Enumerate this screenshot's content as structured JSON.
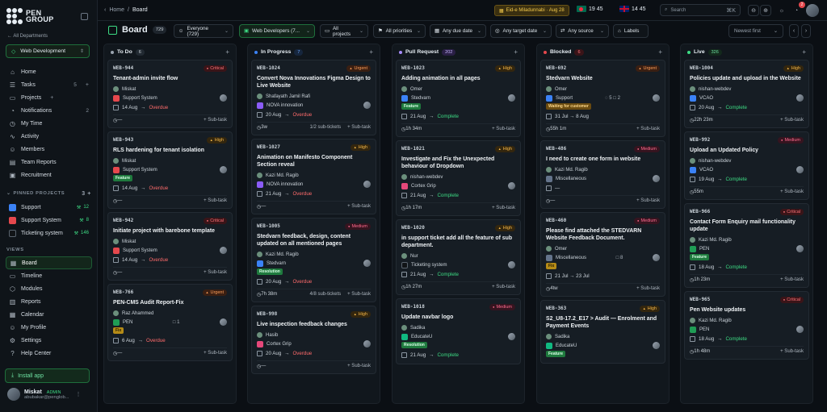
{
  "sidebar": {
    "logo_line1": "PEN",
    "logo_line2": "GROUP",
    "back_label": "← All Departments",
    "workspace": "Web Development",
    "nav": [
      {
        "label": "Home",
        "icon": "home-icon",
        "glyph": "⌂"
      },
      {
        "label": "Tasks",
        "icon": "tasks-icon",
        "glyph": "☰",
        "badge": "5",
        "plus": "+"
      },
      {
        "label": "Projects",
        "icon": "folder-icon",
        "glyph": "▭",
        "plus": "+"
      },
      {
        "label": "Notifications",
        "icon": "bell-icon",
        "glyph": "◔",
        "badge": "2"
      },
      {
        "label": "My Time",
        "icon": "clock-icon",
        "glyph": "◷"
      },
      {
        "label": "Activity",
        "icon": "activity-icon",
        "glyph": "∿"
      },
      {
        "label": "Members",
        "icon": "members-icon",
        "glyph": "☺"
      },
      {
        "label": "Team Reports",
        "icon": "report-icon",
        "glyph": "▤"
      },
      {
        "label": "Recruitment",
        "icon": "briefcase-icon",
        "glyph": "▣"
      }
    ],
    "pinned_title": "PINNED PROJECTS",
    "pinned_tools": "3 +",
    "pinned": [
      {
        "label": "Support",
        "color": "#3b82f6",
        "count": "12"
      },
      {
        "label": "Support System",
        "color": "#e5484d",
        "count": "8"
      },
      {
        "label": "Ticketing system",
        "color": "#111417",
        "count": "146"
      }
    ],
    "views_title": "VIEWS",
    "views": [
      {
        "label": "Board",
        "icon": "board-icon",
        "glyph": "▦",
        "active": true
      },
      {
        "label": "Timeline",
        "icon": "timeline-icon",
        "glyph": "▭"
      },
      {
        "label": "Modules",
        "icon": "modules-icon",
        "glyph": "⬡"
      },
      {
        "label": "Reports",
        "icon": "reports-icon",
        "glyph": "▥"
      },
      {
        "label": "Calendar",
        "icon": "calendar-icon",
        "glyph": "▦"
      },
      {
        "label": "My Profile",
        "icon": "profile-icon",
        "glyph": "☺"
      },
      {
        "label": "Settings",
        "icon": "gear-icon",
        "glyph": "⚙"
      },
      {
        "label": "Help Center",
        "icon": "help-icon",
        "glyph": "?"
      }
    ],
    "install_label": "Install app",
    "user_name": "Miskat",
    "user_role": "ADMIN",
    "user_email": "abubakar@penglob..."
  },
  "topbar": {
    "crumb_home": "Home",
    "crumb_sep": "/",
    "crumb_current": "Board",
    "eid": "Eid-e Miladunnabi · Aug 28",
    "clock_bd": "19 45",
    "clock_uk": "14 45",
    "search_placeholder": "Search",
    "search_kbd": "⌘K",
    "notif_count": "2"
  },
  "filters": {
    "title": "Board",
    "count": "729",
    "everyone": "Everyone (729)",
    "team": "Web Developers (7...",
    "projects": "All projects",
    "priorities": "All priorities",
    "due": "Any due date",
    "target": "Any target date",
    "source": "Any source",
    "labels": "Labels",
    "sort": "Newest first"
  },
  "columns": [
    {
      "name": "To Do",
      "count": "6",
      "dot": "#9aa4af",
      "count_bg": "#222a32",
      "count_color": "#cbd3da",
      "cards": [
        {
          "key": "WEB-944",
          "prio": "Critical",
          "pcls": "critical",
          "title": "Tenant-admin invite flow",
          "person": "Miskat",
          "project": "Support System",
          "pcolor": "#e5484d",
          "date": "14 Aug",
          "status": "Overdue",
          "scls": "overdue",
          "left": "—",
          "sub": "+ Sub-task"
        },
        {
          "key": "WEB-943",
          "prio": "High",
          "pcls": "high",
          "title": "RLS hardening for tenant isolation",
          "person": "Miskat",
          "project": "Support System",
          "pcolor": "#e5484d",
          "tag": "Feature",
          "tcls": "feature",
          "date": "14 Aug",
          "status": "Overdue",
          "scls": "overdue",
          "left": "—",
          "sub": "+ Sub-task"
        },
        {
          "key": "WEB-942",
          "prio": "Critical",
          "pcls": "critical",
          "title": "Initiate project with barebone template",
          "person": "Miskat",
          "project": "Support System",
          "pcolor": "#e5484d",
          "date": "14 Aug",
          "status": "Overdue",
          "scls": "overdue",
          "left": "—",
          "sub": "+ Sub-task"
        },
        {
          "key": "WEB-766",
          "prio": "Urgent",
          "pcls": "urgent",
          "title": "PEN-CMS Audit Report-Fix",
          "person": "Raz Ahammed",
          "project": "PEN",
          "pcolor": "#1f9d55",
          "tag": "Fix",
          "tcls": "fix",
          "meta": "□ 1",
          "date": "6 Aug",
          "status": "Overdue",
          "scls": "overdue",
          "left": "—",
          "sub": "+ Sub-task"
        }
      ]
    },
    {
      "name": "In Progress",
      "count": "7",
      "dot": "#3b82f6",
      "count_bg": "#16263d",
      "count_color": "#6aa5ff",
      "cards": [
        {
          "key": "WEB-1024",
          "prio": "Urgent",
          "pcls": "urgent",
          "title": "Convert Nova Innovations Figma Design to Live Website",
          "person": "Shafayath Jamil Rafi",
          "project": "NOVA innovation",
          "pcolor": "#8b5cf6",
          "date": "20 Aug",
          "status": "Overdue",
          "scls": "overdue",
          "left": "3w",
          "mid": "1/2 sub-tickets",
          "sub": "+ Sub-task"
        },
        {
          "key": "WEB-1027",
          "prio": "High",
          "pcls": "high",
          "title": "Animation on Manifesto Component Section reveal",
          "person": "Kazi Md. Ragib",
          "project": "NOVA innovation",
          "pcolor": "#8b5cf6",
          "date": "21 Aug",
          "status": "Overdue",
          "scls": "overdue",
          "left": "—",
          "sub": "+ Sub-task"
        },
        {
          "key": "WEB-1005",
          "prio": "Medium",
          "pcls": "medium",
          "title": "Stedvarn feedback, design, content updated on all mentioned pages",
          "person": "Kazi Md. Ragib",
          "project": "Stedvarn",
          "pcolor": "#3b82f6",
          "tag": "Resolution",
          "tcls": "resolution",
          "date": "20 Aug",
          "status": "Overdue",
          "scls": "overdue",
          "left": "7h 38m",
          "mid": "4/8 sub-tickets",
          "sub": "+ Sub-task"
        },
        {
          "key": "WEB-998",
          "prio": "High",
          "pcls": "high",
          "title": "Live inspection feedback changes",
          "person": "Hasib",
          "project": "Cortex Grip",
          "pcolor": "#e5487a",
          "date": "20 Aug",
          "status": "Overdue",
          "scls": "overdue",
          "left": "—",
          "sub": "+ Sub-task"
        }
      ]
    },
    {
      "name": "Pull Request",
      "count": "202",
      "dot": "#a78bfa",
      "count_bg": "#2a1f45",
      "count_color": "#c4b5fd",
      "cards": [
        {
          "key": "WEB-1023",
          "prio": "High",
          "pcls": "high",
          "title": "Adding animation in all pages",
          "person": "Omer",
          "project": "Stedvarn",
          "pcolor": "#3b82f6",
          "tag": "Feature",
          "tcls": "feature",
          "date": "21 Aug",
          "status": "Complete",
          "scls": "complete",
          "left": "1h 34m",
          "sub": "+ Sub-task"
        },
        {
          "key": "WEB-1021",
          "prio": "High",
          "pcls": "high",
          "title": "Investigate and Fix the Unexpected behaviour of Dropdown",
          "person": "nishan-webdev",
          "project": "Cortex Grip",
          "pcolor": "#e5487a",
          "date": "21 Aug",
          "status": "Complete",
          "scls": "complete",
          "left": "1h 17m",
          "sub": "+ Sub-task"
        },
        {
          "key": "WEB-1020",
          "prio": "High",
          "pcls": "high",
          "title": "in support ticket add all the feature of sub department.",
          "person": "Nur",
          "project": "Ticketing system",
          "pcolor": "#111417",
          "date": "21 Aug",
          "status": "Complete",
          "scls": "complete",
          "left": "1h 27m",
          "sub": "+ Sub-task"
        },
        {
          "key": "WEB-1018",
          "prio": "Medium",
          "pcls": "medium",
          "title": "Update navbar logo",
          "person": "Sadika",
          "project": "EducateU",
          "pcolor": "#10b981",
          "tag": "Resolution",
          "tcls": "resolution",
          "date": "21 Aug",
          "status": "Complete",
          "scls": "complete",
          "left": "",
          "sub": ""
        }
      ]
    },
    {
      "name": "Blocked",
      "count": "6",
      "dot": "#e5484d",
      "count_bg": "#3a1418",
      "count_color": "#ff7379",
      "cards": [
        {
          "key": "WEB-692",
          "prio": "Urgent",
          "pcls": "urgent",
          "title": "Stedvarn Website",
          "person": "Omer",
          "project": "Support",
          "pcolor": "#3b82f6",
          "tag": "Waiting for customer",
          "tcls": "waiting",
          "meta": "◌ 5   □ 2",
          "date": "31 Jul → 8 Aug",
          "status": "",
          "scls": "",
          "left": "55h 1m",
          "sub": "+ Sub-task"
        },
        {
          "key": "WEB-486",
          "prio": "Medium",
          "pcls": "medium",
          "title": "I need to create one form in website",
          "person": "Kazi Md. Ragib",
          "project": "Miscellaneous",
          "pcolor": "#64748b",
          "date": "—",
          "status": "",
          "scls": "",
          "left": "—",
          "sub": "+ Sub-task"
        },
        {
          "key": "WEB-460",
          "prio": "Medium",
          "pcls": "medium",
          "title": "Please find attached the STEDVARN Website Feedback Document.",
          "person": "Omer",
          "project": "Miscellaneous",
          "pcolor": "#64748b",
          "tag": "Fix",
          "tcls": "fix",
          "meta": "□ 8",
          "date": "21 Jul → 23 Jul",
          "status": "",
          "scls": "",
          "left": "4tw",
          "sub": "+ Sub-task"
        },
        {
          "key": "WEB-363",
          "prio": "High",
          "pcls": "high",
          "title": "S2_U8-17.2_E17 > Audit — Enrolment and Payment Events",
          "person": "Sadika",
          "project": "EducateU",
          "pcolor": "#10b981",
          "tag": "Feature",
          "tcls": "feature",
          "date": "",
          "status": "",
          "scls": "",
          "left": "",
          "sub": ""
        }
      ]
    },
    {
      "name": "Live",
      "count": "326",
      "dot": "#3ddc84",
      "count_bg": "#13291c",
      "count_color": "#6fe3a3",
      "cards": [
        {
          "key": "WEB-1004",
          "prio": "High",
          "pcls": "high",
          "title": "Policies update and upload in the Website",
          "person": "nishan-webdev",
          "project": "VCAO",
          "pcolor": "#3b82f6",
          "date": "20 Aug",
          "status": "Complete",
          "scls": "complete",
          "left": "22h 23m",
          "sub": "+ Sub-task"
        },
        {
          "key": "WEB-992",
          "prio": "Medium",
          "pcls": "medium",
          "title": "Upload an Updated Policy",
          "person": "nishan-webdev",
          "project": "VCAO",
          "pcolor": "#3b82f6",
          "date": "19 Aug",
          "status": "Complete",
          "scls": "complete",
          "left": "55m",
          "sub": "+ Sub-task"
        },
        {
          "key": "WEB-966",
          "prio": "Critical",
          "pcls": "critical",
          "title": "Contact Form Enquiry mail functionality update",
          "person": "Kazi Md. Ragib",
          "project": "PEN",
          "pcolor": "#1f9d55",
          "tag": "Feature",
          "tcls": "feature",
          "date": "18 Aug",
          "status": "Complete",
          "scls": "complete",
          "left": "1h 23m",
          "sub": "+ Sub-task"
        },
        {
          "key": "WEB-965",
          "prio": "Critical",
          "pcls": "critical",
          "title": "Pen Website updates",
          "person": "Kazi Md. Ragib",
          "project": "PEN",
          "pcolor": "#1f9d55",
          "date": "18 Aug",
          "status": "Complete",
          "scls": "complete",
          "left": "1h 48m",
          "sub": "+ Sub-task"
        }
      ]
    }
  ]
}
